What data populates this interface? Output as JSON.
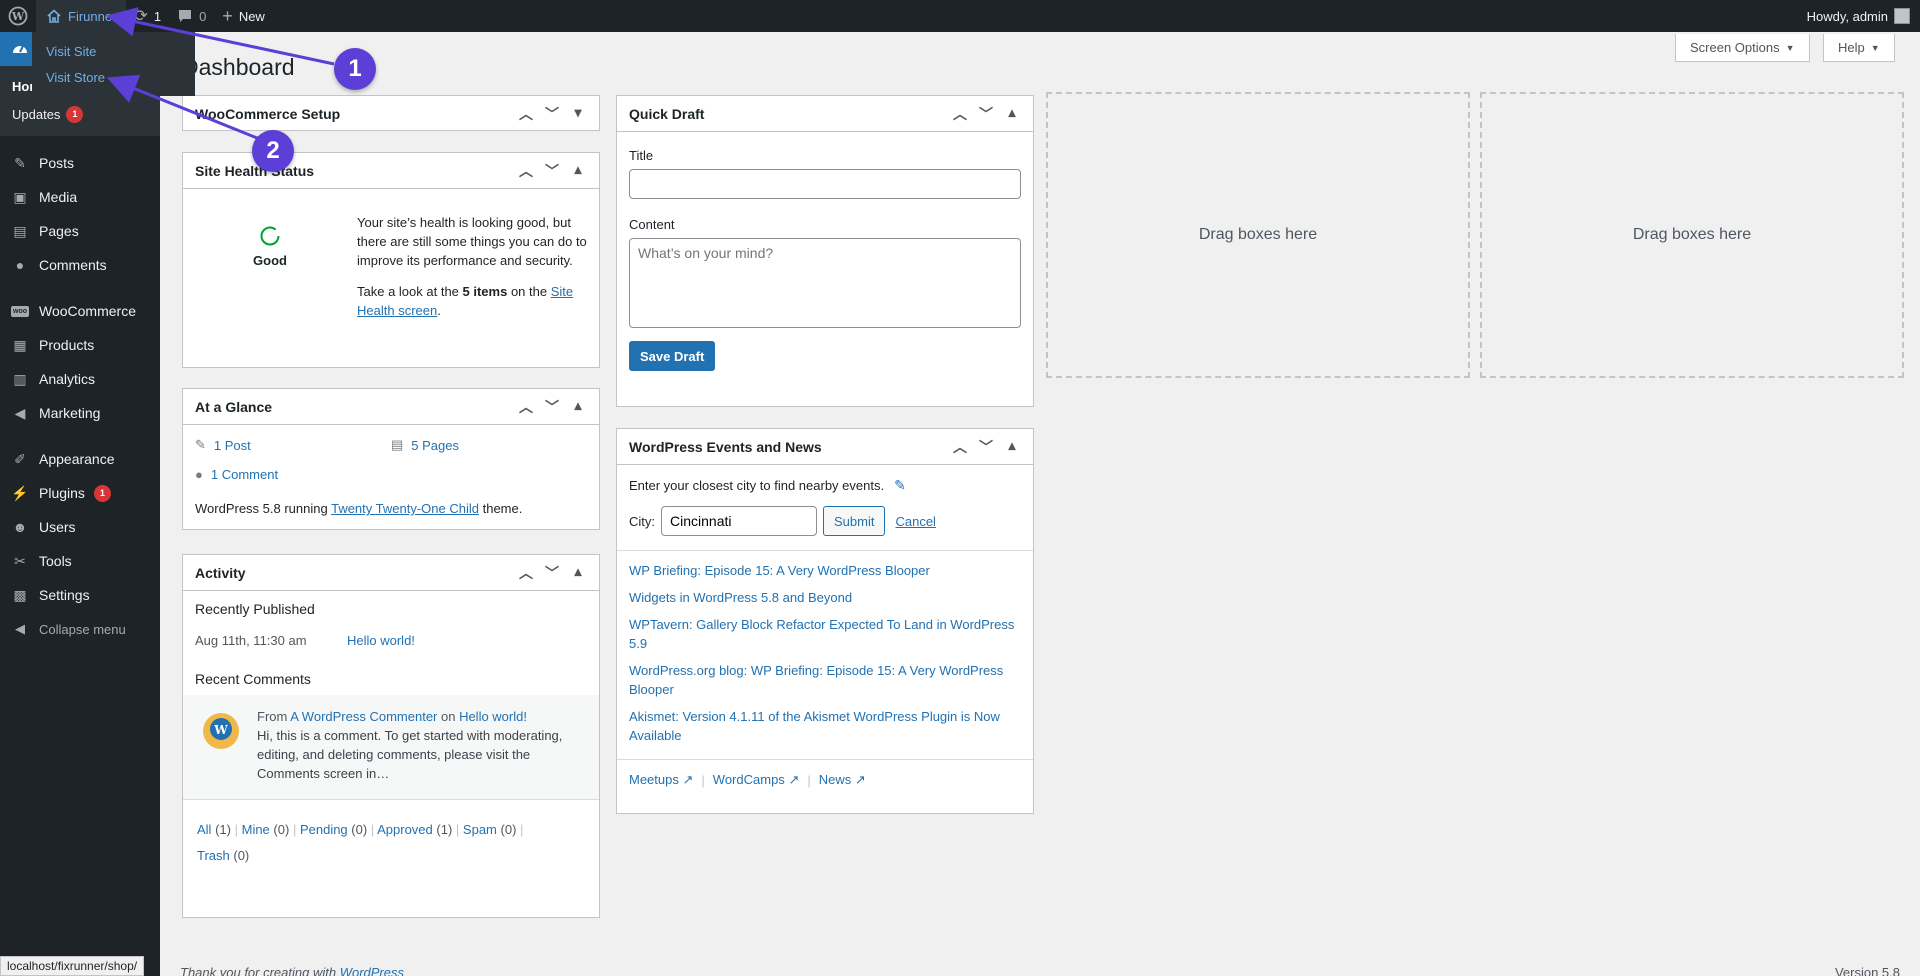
{
  "adminbar": {
    "site_name": "Firunner",
    "updates_count": "1",
    "comments_count": "0",
    "new_label": "New",
    "howdy": "Howdy, admin"
  },
  "flyout": {
    "items": [
      {
        "label": "Visit Site"
      },
      {
        "label": "Visit Store"
      }
    ]
  },
  "sidebar": {
    "home_label": "Home",
    "updates_label": "Updates",
    "updates_badge": "1",
    "menu": [
      {
        "label": "Posts",
        "icon": "pin-icon"
      },
      {
        "label": "Media",
        "icon": "media-icon"
      },
      {
        "label": "Pages",
        "icon": "pages-icon"
      },
      {
        "label": "Comments",
        "icon": "comment-icon"
      },
      {
        "label": "WooCommerce",
        "icon": "woo-icon"
      },
      {
        "label": "Products",
        "icon": "archive-icon"
      },
      {
        "label": "Analytics",
        "icon": "chart-icon"
      },
      {
        "label": "Marketing",
        "icon": "megaphone-icon"
      },
      {
        "label": "Appearance",
        "icon": "brush-icon"
      },
      {
        "label": "Plugins",
        "icon": "plug-icon",
        "badge": "1"
      },
      {
        "label": "Users",
        "icon": "user-icon"
      },
      {
        "label": "Tools",
        "icon": "wrench-icon"
      },
      {
        "label": "Settings",
        "icon": "settings-icon"
      }
    ],
    "collapse_label": "Collapse menu"
  },
  "header": {
    "title": "Dashboard",
    "screen_options": "Screen Options",
    "help": "Help"
  },
  "woo_setup": {
    "title": "WooCommerce Setup"
  },
  "site_health": {
    "title": "Site Health Status",
    "status": "Good",
    "text": "Your site’s health is looking good, but there are still some things you can do to improve its performance and security.",
    "look_pre": "Take a look at the ",
    "items_bold": "5 items",
    "look_mid": " on the ",
    "link": "Site Health screen",
    "look_end": "."
  },
  "glance": {
    "title": "At a Glance",
    "posts": "1 Post",
    "pages": "5 Pages",
    "comments": "1 Comment",
    "running_pre": "WordPress 5.8 running ",
    "theme": "Twenty Twenty-One Child",
    "running_post": " theme."
  },
  "activity": {
    "title": "Activity",
    "recently_published": "Recently Published",
    "pub_date": "Aug 11th, 11:30 am",
    "pub_link": "Hello world!",
    "recent_comments": "Recent Comments",
    "from": "From ",
    "commenter": "A WordPress Commenter",
    "on": " on ",
    "comment_post": "Hello world!",
    "excerpt": "Hi, this is a comment. To get started with moderating, editing, and deleting comments, please visit the Comments screen in…",
    "filters": [
      {
        "label": "All",
        "count": "(1)"
      },
      {
        "label": "Mine",
        "count": "(0)"
      },
      {
        "label": "Pending",
        "count": "(0)"
      },
      {
        "label": "Approved",
        "count": "(1)"
      },
      {
        "label": "Spam",
        "count": "(0)"
      },
      {
        "label": "Trash",
        "count": "(0)"
      }
    ]
  },
  "quick_draft": {
    "title": "Quick Draft",
    "title_label": "Title",
    "content_label": "Content",
    "content_placeholder": "What’s on your mind?",
    "save": "Save Draft"
  },
  "events": {
    "title": "WordPress Events and News",
    "intro": "Enter your closest city to find nearby events.",
    "city_label": "City:",
    "city_value": "Cincinnati",
    "submit": "Submit",
    "cancel": "Cancel",
    "news": [
      "WP Briefing: Episode 15: A Very WordPress Blooper",
      "Widgets in WordPress 5.8 and Beyond",
      "WPTavern: Gallery Block Refactor Expected To Land in WordPress 5.9",
      "WordPress.org blog: WP Briefing: Episode 15: A Very WordPress Blooper",
      "Akismet: Version 4.1.11 of the Akismet WordPress Plugin is Now Available"
    ],
    "footer_links": [
      "Meetups",
      "WordCamps",
      "News"
    ]
  },
  "drop_zones": [
    "Drag boxes here",
    "Drag boxes here"
  ],
  "footer": {
    "thanks_pre": "Thank you for creating with ",
    "thanks_link": "WordPress",
    "version": "Version 5.8"
  },
  "status_url": "localhost/fixrunner/shop/",
  "annotations": [
    "1",
    "2"
  ],
  "colors": {
    "accent": "#2271b1",
    "annotation": "#5b3fd6",
    "badge": "#d63638",
    "admin_bg": "#1d2327"
  }
}
